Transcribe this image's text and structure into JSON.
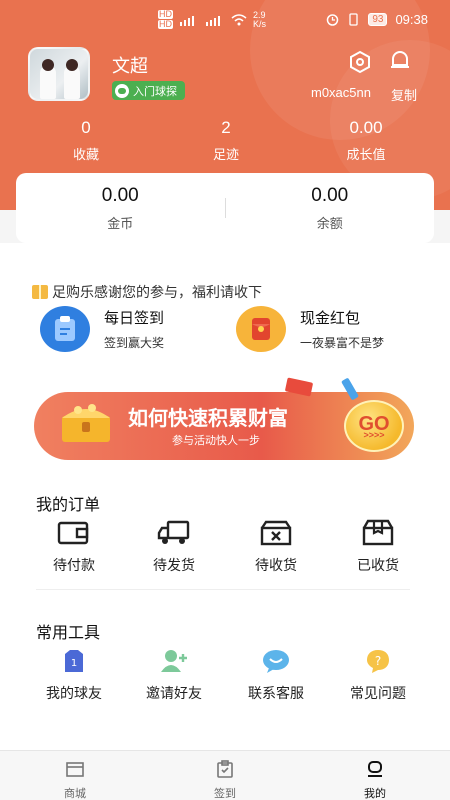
{
  "status": {
    "network_top": "HD",
    "network_bottom": "HD",
    "speed": "2.9",
    "speed_unit": "K/s",
    "battery": "93",
    "time": "09:38"
  },
  "profile": {
    "name": "文超",
    "badge": "入门球探",
    "uid": "m0xac5nn",
    "copy_label": "复制"
  },
  "stats": [
    {
      "value": "0",
      "label": "收藏"
    },
    {
      "value": "2",
      "label": "足迹"
    },
    {
      "value": "0.00",
      "label": "成长值"
    }
  ],
  "wallet": [
    {
      "value": "0.00",
      "label": "金币"
    },
    {
      "value": "0.00",
      "label": "余额"
    }
  ],
  "thanks_text": "足购乐感谢您的参与，福利请收下",
  "promos": [
    {
      "title": "每日签到",
      "subtitle": "签到赢大奖"
    },
    {
      "title": "现金红包",
      "subtitle": "一夜暴富不是梦"
    }
  ],
  "banner": {
    "title": "如何快速积累财富",
    "subtitle": "参与活动快人一步",
    "go": "GO",
    "arrows": ">>>>"
  },
  "orders": {
    "title": "我的订单",
    "items": [
      {
        "label": "待付款",
        "icon": "wallet-icon"
      },
      {
        "label": "待发货",
        "icon": "truck-icon"
      },
      {
        "label": "待收货",
        "icon": "box-x-icon"
      },
      {
        "label": "已收货",
        "icon": "box-open-icon"
      }
    ]
  },
  "tools": {
    "title": "常用工具",
    "items": [
      {
        "label": "我的球友",
        "icon": "jersey-icon"
      },
      {
        "label": "邀请好友",
        "icon": "add-friend-icon"
      },
      {
        "label": "联系客服",
        "icon": "chat-icon"
      },
      {
        "label": "常见问题",
        "icon": "question-icon"
      }
    ]
  },
  "tabs": [
    {
      "label": "商城",
      "icon": "store-icon"
    },
    {
      "label": "签到",
      "icon": "checkin-icon"
    },
    {
      "label": "我的",
      "icon": "profile-icon",
      "active": true
    }
  ],
  "colors": {
    "header": "#e9724f",
    "accent": "#e85a4a",
    "badge": "#4caf50"
  }
}
